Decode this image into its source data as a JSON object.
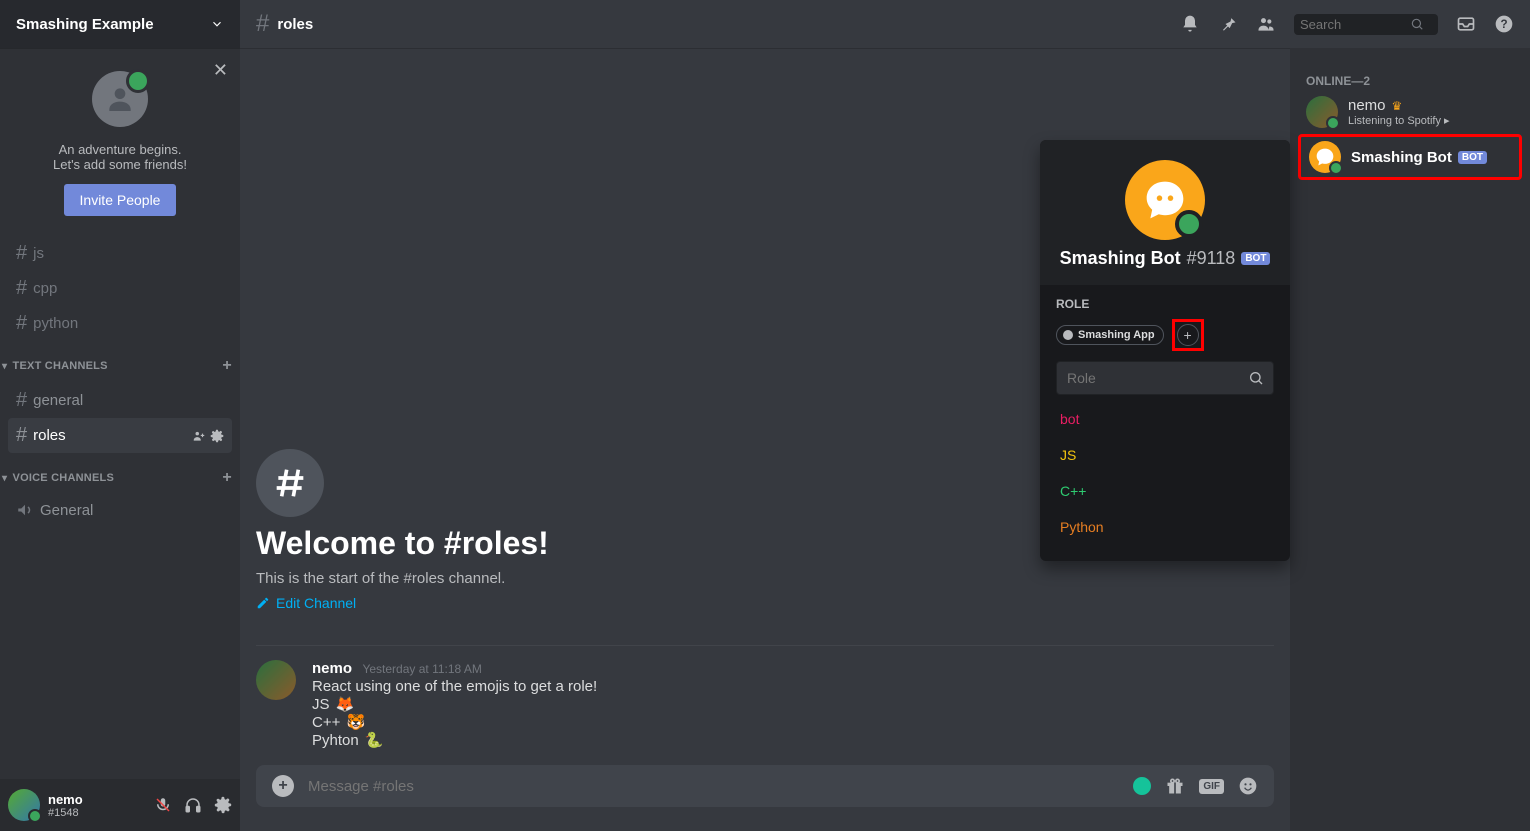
{
  "server": {
    "name": "Smashing Example"
  },
  "invite": {
    "line1": "An adventure begins.",
    "line2": "Let's add some friends!",
    "button": "Invite People"
  },
  "sidebar_channels_bare": [
    "js",
    "cpp",
    "python"
  ],
  "category_text": "TEXT CHANNELS",
  "category_voice": "VOICE CHANNELS",
  "text_channels": [
    {
      "name": "general",
      "active": false
    },
    {
      "name": "roles",
      "active": true
    }
  ],
  "voice_channels": [
    "General"
  ],
  "footer_user": {
    "name": "nemo",
    "tag": "#1548"
  },
  "header": {
    "channel": "roles",
    "search_placeholder": "Search"
  },
  "welcome": {
    "title": "Welcome to #roles!",
    "sub": "This is the start of the #roles channel.",
    "edit": "Edit Channel"
  },
  "message": {
    "author": "nemo",
    "timestamp": "Yesterday at 11:18 AM",
    "line1": "React using one of the emojis to get a role!",
    "line_js": "JS",
    "emoji_js": "🦊",
    "line_cpp": "C++",
    "emoji_cpp": "🐯",
    "line_py": "Pyhton",
    "emoji_py": "🐍"
  },
  "compose": {
    "placeholder": "Message #roles"
  },
  "gif_label": "GIF",
  "members": {
    "heading": "ONLINE—2",
    "user1": {
      "name": "nemo",
      "status": "Listening to Spotify"
    },
    "bot": {
      "name": "Smashing Bot",
      "badge": "BOT"
    }
  },
  "popup": {
    "name": "Smashing Bot",
    "discrim": "#9118",
    "badge": "BOT",
    "section": "ROLE",
    "role_chip": "Smashing App",
    "search_placeholder": "Role",
    "options": [
      {
        "label": "bot",
        "color": "#e91e63"
      },
      {
        "label": "JS",
        "color": "#f1c40f"
      },
      {
        "label": "C++",
        "color": "#2ecc71"
      },
      {
        "label": "Python",
        "color": "#e67e22"
      }
    ]
  }
}
